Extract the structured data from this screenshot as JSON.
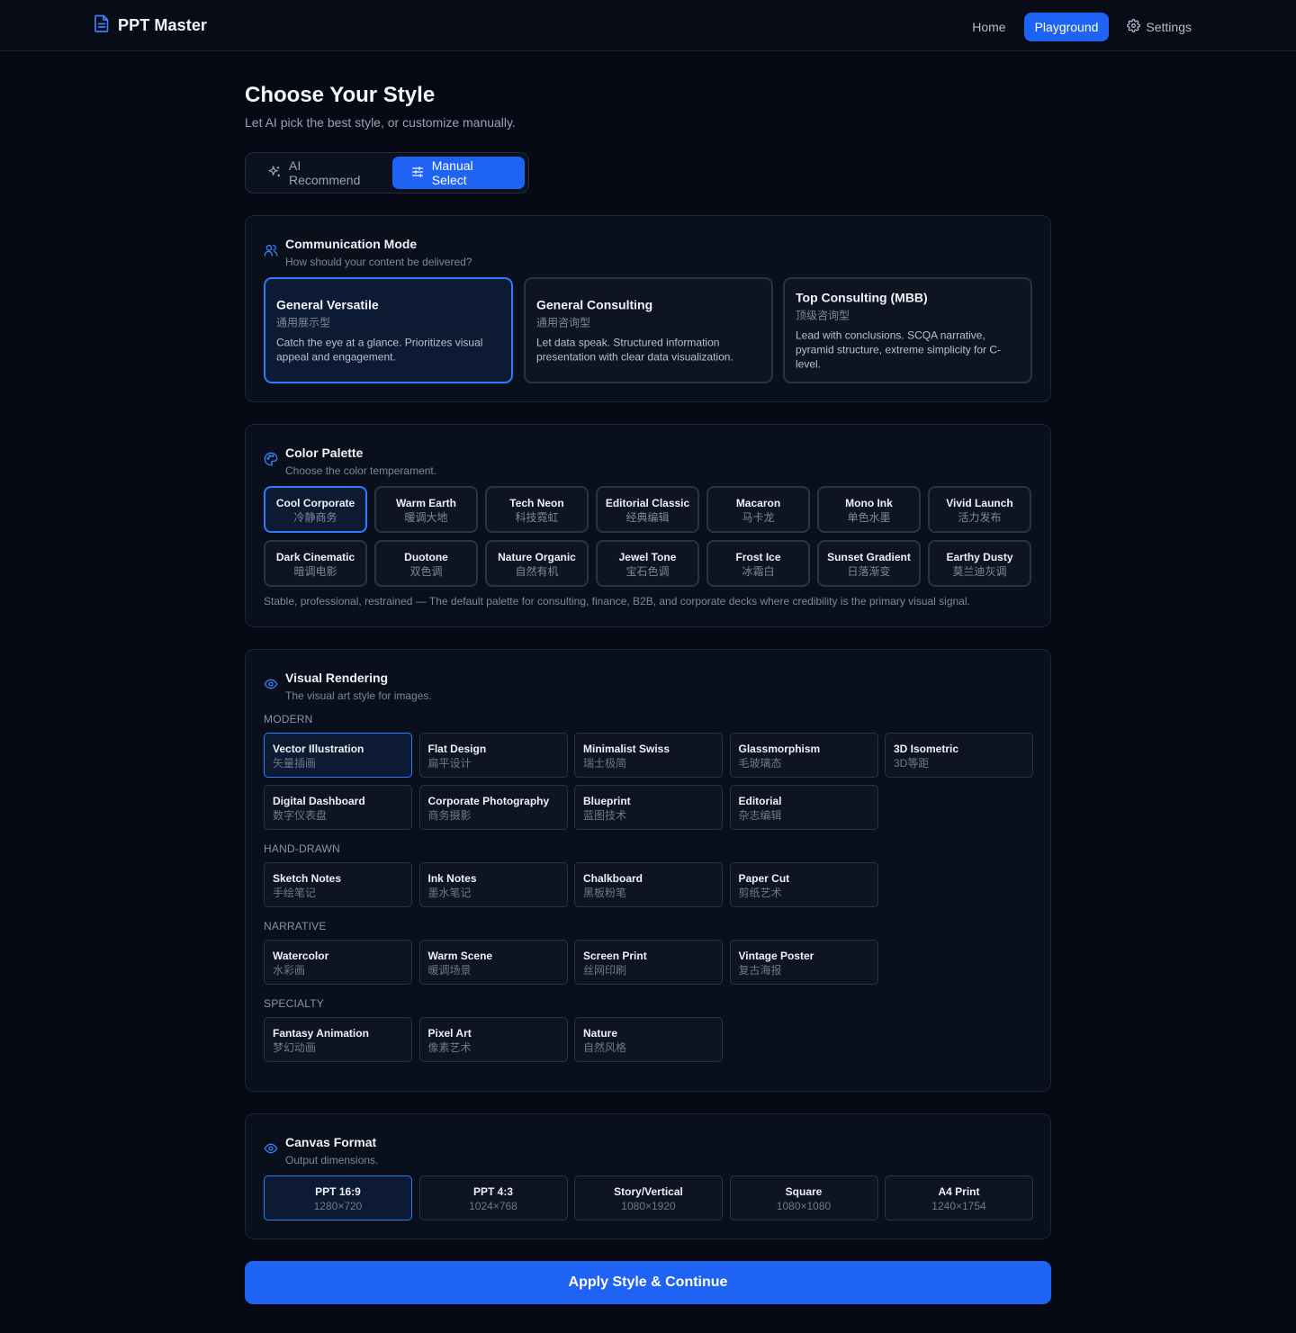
{
  "nav": {
    "brand": "PPT Master",
    "links": [
      {
        "label": "Home",
        "active": false
      },
      {
        "label": "Playground",
        "active": true
      },
      {
        "label": "Settings",
        "active": false
      }
    ]
  },
  "header": {
    "title": "Choose Your Style",
    "subtitle": "Let AI pick the best style, or customize manually."
  },
  "mode_toggle": {
    "ai_label": "AI Recommend",
    "manual_label": "Manual Select",
    "selected": "manual"
  },
  "communication": {
    "title": "Communication Mode",
    "subtitle": "How should your content be delivered?",
    "options": [
      {
        "title": "General Versatile",
        "cn": "通用展示型",
        "desc": "Catch the eye at a glance. Prioritizes visual appeal and engagement.",
        "selected": true
      },
      {
        "title": "General Consulting",
        "cn": "通用咨询型",
        "desc": "Let data speak. Structured information presentation with clear data visualization.",
        "selected": false
      },
      {
        "title": "Top Consulting (MBB)",
        "cn": "顶级咨询型",
        "desc": "Lead with conclusions. SCQA narrative, pyramid structure, extreme simplicity for C-level.",
        "selected": false
      }
    ]
  },
  "palette": {
    "title": "Color Palette",
    "subtitle": "Choose the color temperament.",
    "options": [
      {
        "title": "Cool Corporate",
        "cn": "冷静商务",
        "selected": true
      },
      {
        "title": "Warm Earth",
        "cn": "暖调大地"
      },
      {
        "title": "Tech Neon",
        "cn": "科技霓虹"
      },
      {
        "title": "Editorial Classic",
        "cn": "经典编辑"
      },
      {
        "title": "Macaron",
        "cn": "马卡龙"
      },
      {
        "title": "Mono Ink",
        "cn": "单色水墨"
      },
      {
        "title": "Vivid Launch",
        "cn": "活力发布"
      },
      {
        "title": "Dark Cinematic",
        "cn": "暗调电影"
      },
      {
        "title": "Duotone",
        "cn": "双色调"
      },
      {
        "title": "Nature Organic",
        "cn": "自然有机"
      },
      {
        "title": "Jewel Tone",
        "cn": "宝石色调"
      },
      {
        "title": "Frost Ice",
        "cn": "冰霜白"
      },
      {
        "title": "Sunset Gradient",
        "cn": "日落渐变"
      },
      {
        "title": "Earthy Dusty",
        "cn": "莫兰迪灰调"
      }
    ],
    "note": "Stable, professional, restrained — The default palette for consulting, finance, B2B, and corporate decks where credibility is the primary visual signal."
  },
  "rendering": {
    "title": "Visual Rendering",
    "subtitle": "The visual art style for images.",
    "groups": [
      {
        "label": "MODERN",
        "items": [
          {
            "title": "Vector Illustration",
            "cn": "矢量插画",
            "selected": true
          },
          {
            "title": "Flat Design",
            "cn": "扁平设计"
          },
          {
            "title": "Minimalist Swiss",
            "cn": "瑞士极简"
          },
          {
            "title": "Glassmorphism",
            "cn": "毛玻璃态"
          },
          {
            "title": "3D Isometric",
            "cn": "3D等距"
          },
          {
            "title": "Digital Dashboard",
            "cn": "数字仪表盘"
          },
          {
            "title": "Corporate Photography",
            "cn": "商务摄影"
          },
          {
            "title": "Blueprint",
            "cn": "蓝图技术"
          },
          {
            "title": "Editorial",
            "cn": "杂志编辑"
          }
        ]
      },
      {
        "label": "HAND-DRAWN",
        "items": [
          {
            "title": "Sketch Notes",
            "cn": "手绘笔记"
          },
          {
            "title": "Ink Notes",
            "cn": "墨水笔记"
          },
          {
            "title": "Chalkboard",
            "cn": "黑板粉笔"
          },
          {
            "title": "Paper Cut",
            "cn": "剪纸艺术"
          }
        ]
      },
      {
        "label": "NARRATIVE",
        "items": [
          {
            "title": "Watercolor",
            "cn": "水彩画"
          },
          {
            "title": "Warm Scene",
            "cn": "暖调场景"
          },
          {
            "title": "Screen Print",
            "cn": "丝网印刷"
          },
          {
            "title": "Vintage Poster",
            "cn": "复古海报"
          }
        ]
      },
      {
        "label": "SPECIALTY",
        "items": [
          {
            "title": "Fantasy Animation",
            "cn": "梦幻动画"
          },
          {
            "title": "Pixel Art",
            "cn": "像素艺术"
          },
          {
            "title": "Nature",
            "cn": "自然风格"
          }
        ]
      }
    ]
  },
  "canvas": {
    "title": "Canvas Format",
    "subtitle": "Output dimensions.",
    "options": [
      {
        "title": "PPT 16:9",
        "dim": "1280×720",
        "selected": true
      },
      {
        "title": "PPT 4:3",
        "dim": "1024×768"
      },
      {
        "title": "Story/Vertical",
        "dim": "1080×1920"
      },
      {
        "title": "Square",
        "dim": "1080×1080"
      },
      {
        "title": "A4 Print",
        "dim": "1240×1754"
      }
    ]
  },
  "apply_label": "Apply Style & Continue",
  "colors": {
    "accent": "#1f63f5",
    "selected_border": "#2f7bff",
    "background": "#050a14"
  }
}
